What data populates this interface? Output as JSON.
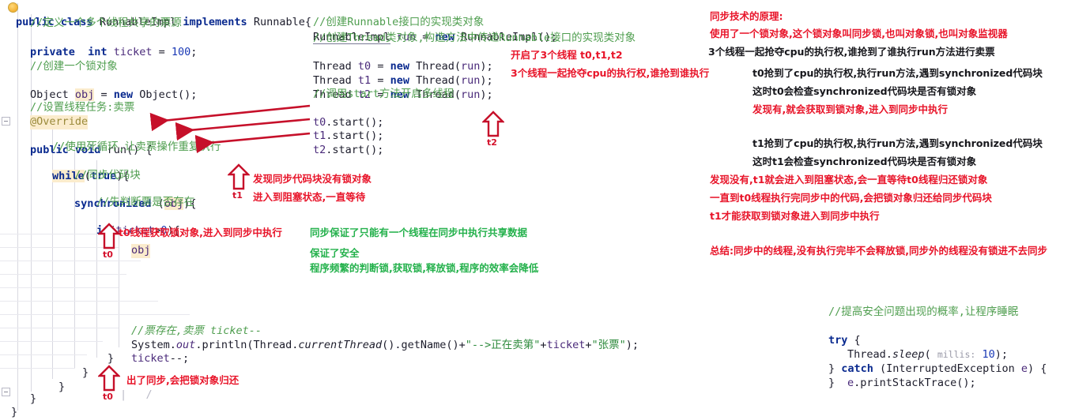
{
  "editor": {
    "left_code": [
      {
        "t": "public class RunnableImpl implements Runnable{"
      },
      {
        "t": "//定义一个多个线程共享的票源"
      },
      {
        "t": "private  int ticket = 100;"
      },
      {
        "t": "//创建一个锁对象"
      },
      {
        "t": "Object obj = new Object();"
      },
      {
        "t": "//设置线程任务:卖票"
      },
      {
        "t": "@Override"
      },
      {
        "t": "public void run() {"
      },
      {
        "t": "//使用死循环,让卖票操作重复执行"
      },
      {
        "t": "while(true){"
      },
      {
        "t": "//同步代码块"
      },
      {
        "t": "synchronized (obj){"
      },
      {
        "t": "//先判断票是否存在"
      },
      {
        "t": "if(ticket>0){"
      },
      {
        "t": "obj;"
      },
      {
        "t": "//票存在,卖票 ticket--"
      },
      {
        "t": "System.out.println(Thread.currentThread().getName()+\"-->正在卖第\"+ticket+\"张票\");"
      },
      {
        "t": "ticket--;"
      },
      {
        "t": "}"
      },
      {
        "t": "}"
      },
      {
        "t": "}"
      },
      {
        "t": "}"
      },
      {
        "t": "}"
      }
    ],
    "mid_code": [
      {
        "t": "//创建Runnable接口的实现类对象"
      },
      {
        "t": "RunnableImpl run = new RunnableImpl();"
      },
      {
        "t": "//创建Thread类对象,构造方法中传递Runnable接口的实现类对象"
      },
      {
        "t": "Thread t0 = new Thread(run);"
      },
      {
        "t": "Thread t1 = new Thread(run);"
      },
      {
        "t": "Thread t2 = new Thread(run);"
      },
      {
        "t": "//调用start方法开启多线程"
      },
      {
        "t": "t0.start();"
      },
      {
        "t": "t1.start();"
      },
      {
        "t": "t2.start();"
      }
    ],
    "bottom_right_code": [
      {
        "t": "//提高安全问题出现的概率,让程序睡眠"
      },
      {
        "t": "try {"
      },
      {
        "t": "Thread.sleep( millis: 10);"
      },
      {
        "t": "} catch (InterruptedException e) {"
      },
      {
        "t": "e.printStackTrace();"
      },
      {
        "t": "}"
      }
    ],
    "tokens": {
      "public": "public",
      "class": "class",
      "RunnableImpl": "RunnableImpl",
      "implements": "implements",
      "Runnable": "Runnable",
      "private": "private",
      "int": "int",
      "ticket": "ticket",
      "hundred": "100",
      "Object": "Object",
      "obj": "obj",
      "new": "new",
      "override": "@Override",
      "void": "void",
      "run": "run",
      "while": "while",
      "true": "true",
      "synchronized": "synchronized",
      "if": "if",
      "System": "System",
      "out": "out",
      "println": "println",
      "Thread": "Thread",
      "currentThread": "currentThread",
      "getName": "getName",
      "str_arrow": "\"-->正在卖第\"",
      "str_zhang": "\"张票\"",
      "sleep": "sleep",
      "millis_hint": "millis:",
      "ten": "10",
      "try": "try",
      "catch": "catch",
      "InterruptedException": "InterruptedException",
      "e": "e",
      "printStackTrace": "printStackTrace",
      "start": "start",
      "t0var": "t0",
      "t1var": "t1",
      "t2var": "t2",
      "runvar": "run"
    },
    "comments": {
      "c_ticket_src": "//定义一个多个线程共享的票源",
      "c_lock_obj": "//创建一个锁对象",
      "c_task": "//设置线程任务:卖票",
      "c_loop": "//使用死循环,让卖票操作重复执行",
      "c_sync_block": "//同步代码块",
      "c_judge": "//先判断票是否存在",
      "c_sell": "//票存在,卖票 ticket--",
      "c_create_impl": "//创建Runnable接口的实现类对象",
      "c_create_thread": "//创建Thread类对象,构造方法中传递Runnable接口的实现类对象",
      "c_call_start": "//调用start方法开启多线程",
      "c_sleep": "//提高安全问题出现的概率,让程序睡眠"
    }
  },
  "annotations": {
    "mid_red": [
      {
        "text": "开启了3个线程 t0,t1,t2"
      },
      {
        "text": "3个线程一起抢夺cpu的执行权,谁抢到谁执行"
      }
    ],
    "t1_block": [
      {
        "text": "发现同步代码块没有锁对象"
      },
      {
        "text": "进入到阻塞状态,一直等待"
      }
    ],
    "t0_lock": "t0线程获取锁对象,进入到同步中执行",
    "t0_release": "出了同步,会把锁对象归还",
    "green_block": [
      {
        "text": "同步保证了只能有一个线程在同步中执行共享数据"
      },
      {
        "text": "保证了安全"
      },
      {
        "text": "程序频繁的判断锁,获取锁,释放锁,程序的效率会降低"
      }
    ],
    "right_panel": {
      "title": "同步技术的原理:",
      "lines": [
        {
          "text": "使用了一个锁对象,这个锁对象叫同步锁,也叫对象锁,也叫对象监视器",
          "color": "red",
          "indent": 0
        },
        {
          "text": "3个线程一起抢夺cpu的执行权,谁抢到了谁执行run方法进行卖票",
          "color": "black",
          "indent": 0
        },
        {
          "text": "t0抢到了cpu的执行权,执行run方法,遇到synchronized代码块",
          "color": "black",
          "indent": 1
        },
        {
          "text": "这时t0会检查synchronized代码块是否有锁对象",
          "color": "black",
          "indent": 1
        },
        {
          "text": "发现有,就会获取到锁对象,进入到同步中执行",
          "color": "red",
          "indent": 1
        },
        {
          "text": "",
          "color": "black",
          "indent": 0
        },
        {
          "text": "t1抢到了cpu的执行权,执行run方法,遇到synchronized代码块",
          "color": "black",
          "indent": 1
        },
        {
          "text": "这时t1会检查synchronized代码块是否有锁对象",
          "color": "black",
          "indent": 1
        },
        {
          "text": "发现没有,t1就会进入到阻塞状态,会一直等待t0线程归还锁对象",
          "color": "red",
          "indent": 1
        },
        {
          "text": "一直到t0线程执行完同步中的代码,会把锁对象归还给同步代码块",
          "color": "red",
          "indent": 1
        },
        {
          "text": "t1才能获取到锁对象进入到同步中执行",
          "color": "red",
          "indent": 1
        }
      ],
      "summary": "总结:同步中的线程,没有执行完毕不会释放锁,同步外的线程没有锁进不去同步"
    },
    "thread_tags": {
      "t0": "t0",
      "t1": "t1",
      "t2": "t2"
    }
  },
  "colors": {
    "red": "#e8152a",
    "dark_red": "#c6102a",
    "green": "#24b14c",
    "comment_green": "#4f9e4f",
    "keyword_blue": "#0a2a8f",
    "string_green": "#2e8b3d",
    "background": "#ffffff"
  }
}
